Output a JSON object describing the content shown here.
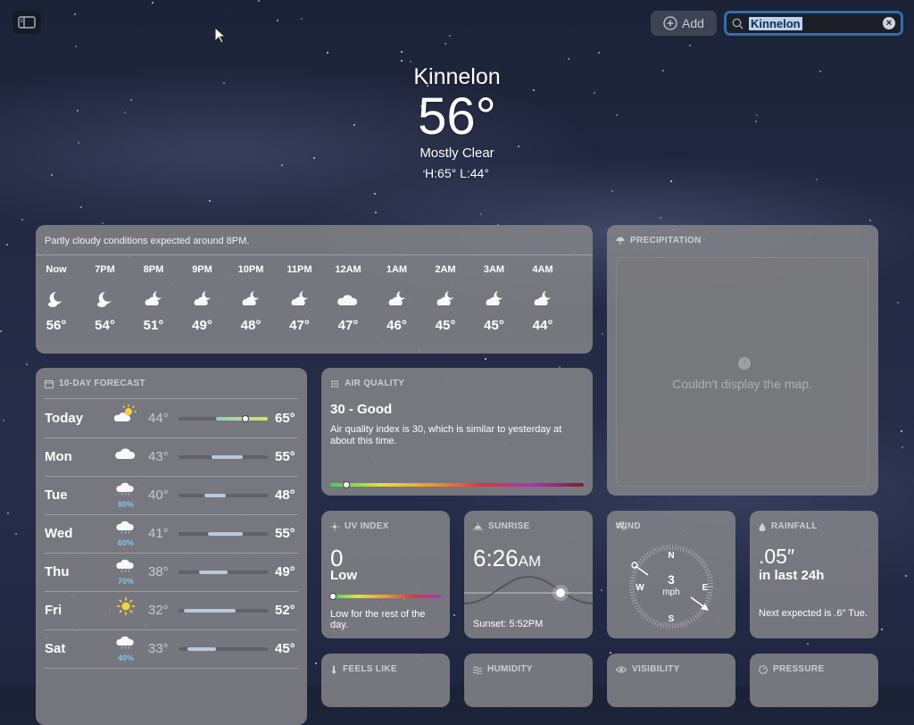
{
  "toolbar": {
    "add_label": "Add",
    "search_value": "Kinnelon"
  },
  "header": {
    "city": "Kinnelon",
    "temperature": "56°",
    "condition": "Mostly Clear",
    "high_low": "H:65°  L:44°"
  },
  "hourly": {
    "summary": "Partly cloudy conditions expected around 8PM.",
    "hours": [
      {
        "time": "Now",
        "icon": "moon-cloud-icon",
        "temp": "56°"
      },
      {
        "time": "7PM",
        "icon": "moon-cloud-icon",
        "temp": "54°"
      },
      {
        "time": "8PM",
        "icon": "partly-cloudy-night-icon",
        "temp": "51°"
      },
      {
        "time": "9PM",
        "icon": "partly-cloudy-night-icon",
        "temp": "49°"
      },
      {
        "time": "10PM",
        "icon": "partly-cloudy-night-icon",
        "temp": "48°"
      },
      {
        "time": "11PM",
        "icon": "partly-cloudy-night-icon",
        "temp": "47°"
      },
      {
        "time": "12AM",
        "icon": "cloud-icon",
        "temp": "47°"
      },
      {
        "time": "1AM",
        "icon": "partly-cloudy-night-icon",
        "temp": "46°"
      },
      {
        "time": "2AM",
        "icon": "partly-cloudy-night-icon",
        "temp": "45°"
      },
      {
        "time": "3AM",
        "icon": "partly-cloudy-night-icon",
        "temp": "45°"
      },
      {
        "time": "4AM",
        "icon": "partly-cloudy-night-icon",
        "temp": "44°"
      }
    ]
  },
  "precipitation": {
    "title": "PRECIPITATION",
    "map_message": "Couldn't display the map."
  },
  "forecast": {
    "title": "10-DAY FORECAST",
    "days": [
      {
        "day": "Today",
        "icon": "partly-sunny-icon",
        "precip": "",
        "low": "44°",
        "high": "65°",
        "range": [
          0.42,
          1.0
        ],
        "current": 0.74
      },
      {
        "day": "Mon",
        "icon": "cloud-icon",
        "precip": "",
        "low": "43°",
        "high": "55°",
        "range": [
          0.37,
          0.72
        ]
      },
      {
        "day": "Tue",
        "icon": "rain-cloud-icon",
        "precip": "80%",
        "low": "40°",
        "high": "48°",
        "range": [
          0.29,
          0.53
        ]
      },
      {
        "day": "Wed",
        "icon": "rain-cloud-icon",
        "precip": "60%",
        "low": "41°",
        "high": "55°",
        "range": [
          0.33,
          0.72
        ]
      },
      {
        "day": "Thu",
        "icon": "rain-cloud-icon",
        "precip": "70%",
        "low": "38°",
        "high": "49°",
        "range": [
          0.23,
          0.55
        ]
      },
      {
        "day": "Fri",
        "icon": "sun-icon",
        "precip": "",
        "low": "32°",
        "high": "52°",
        "range": [
          0.06,
          0.64
        ]
      },
      {
        "day": "Sat",
        "icon": "rain-cloud-icon",
        "precip": "40%",
        "low": "33°",
        "high": "45°",
        "range": [
          0.1,
          0.42
        ]
      }
    ]
  },
  "air_quality": {
    "title": "AIR QUALITY",
    "value": "30 - Good",
    "description": "Air quality index is 30, which is similar to yesterday at about this time.",
    "level": 0.06
  },
  "uv_index": {
    "title": "UV INDEX",
    "value": "0",
    "level": "Low",
    "note": "Low for the rest of the day.",
    "scale_position": 0.0
  },
  "sunrise": {
    "title": "SUNRISE",
    "time": "6:26",
    "ampm": "AM",
    "sunset": "Sunset: 5:52PM"
  },
  "wind": {
    "title": "WIND",
    "speed": "3",
    "unit": "mph",
    "compass": {
      "n": "N",
      "e": "E",
      "s": "S",
      "w": "W"
    }
  },
  "rainfall": {
    "title": "RAINFALL",
    "value": ".05″",
    "period": "in last 24h",
    "note": "Next expected is .6″ Tue."
  },
  "bottom_cards": {
    "feels_like": "FEELS LIKE",
    "humidity": "HUMIDITY",
    "visibility": "VISIBILITY",
    "pressure": "PRESSURE"
  }
}
